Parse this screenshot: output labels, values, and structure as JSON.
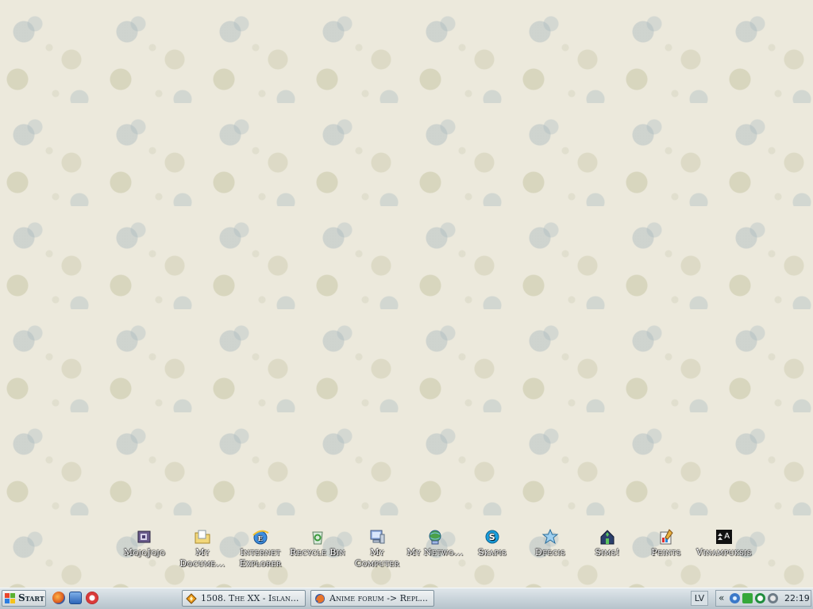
{
  "desktop": {
    "icons": [
      {
        "name": "mojojojo-icon",
        "label": "MojoJojo"
      },
      {
        "name": "my-documents-icon",
        "label": "My Docume..."
      },
      {
        "name": "internet-explorer-icon",
        "label": "Internet Explorer"
      },
      {
        "name": "recycle-bin-icon",
        "label": "Recycle Bin"
      },
      {
        "name": "my-computer-icon",
        "label": "My Computer"
      },
      {
        "name": "my-network-icon",
        "label": "My Netwo..."
      },
      {
        "name": "skype-icon",
        "label": "Skapis"
      },
      {
        "name": "dfecis-icon",
        "label": "Dfecis"
      },
      {
        "name": "sims-icon",
        "label": "Sims!"
      },
      {
        "name": "peints-icon",
        "label": "Peints"
      },
      {
        "name": "vinampuksis-icon",
        "label": "Vinampuksis"
      }
    ]
  },
  "taskbar": {
    "start_label": "Start",
    "quick_launch": [
      "firefox-icon",
      "show-desktop-icon",
      "opera-icon"
    ],
    "tasks": [
      {
        "label": "1508. The XX - Islan...",
        "icon": "winamp-icon"
      },
      {
        "label": "Anime forum -> Repl...",
        "icon": "firefox-icon"
      }
    ],
    "language": "LV",
    "tray_expand": "«",
    "tray_icons": [
      "network-icon",
      "antivirus-icon",
      "utorrent-icon",
      "messenger-icon"
    ],
    "clock": "22:19"
  }
}
